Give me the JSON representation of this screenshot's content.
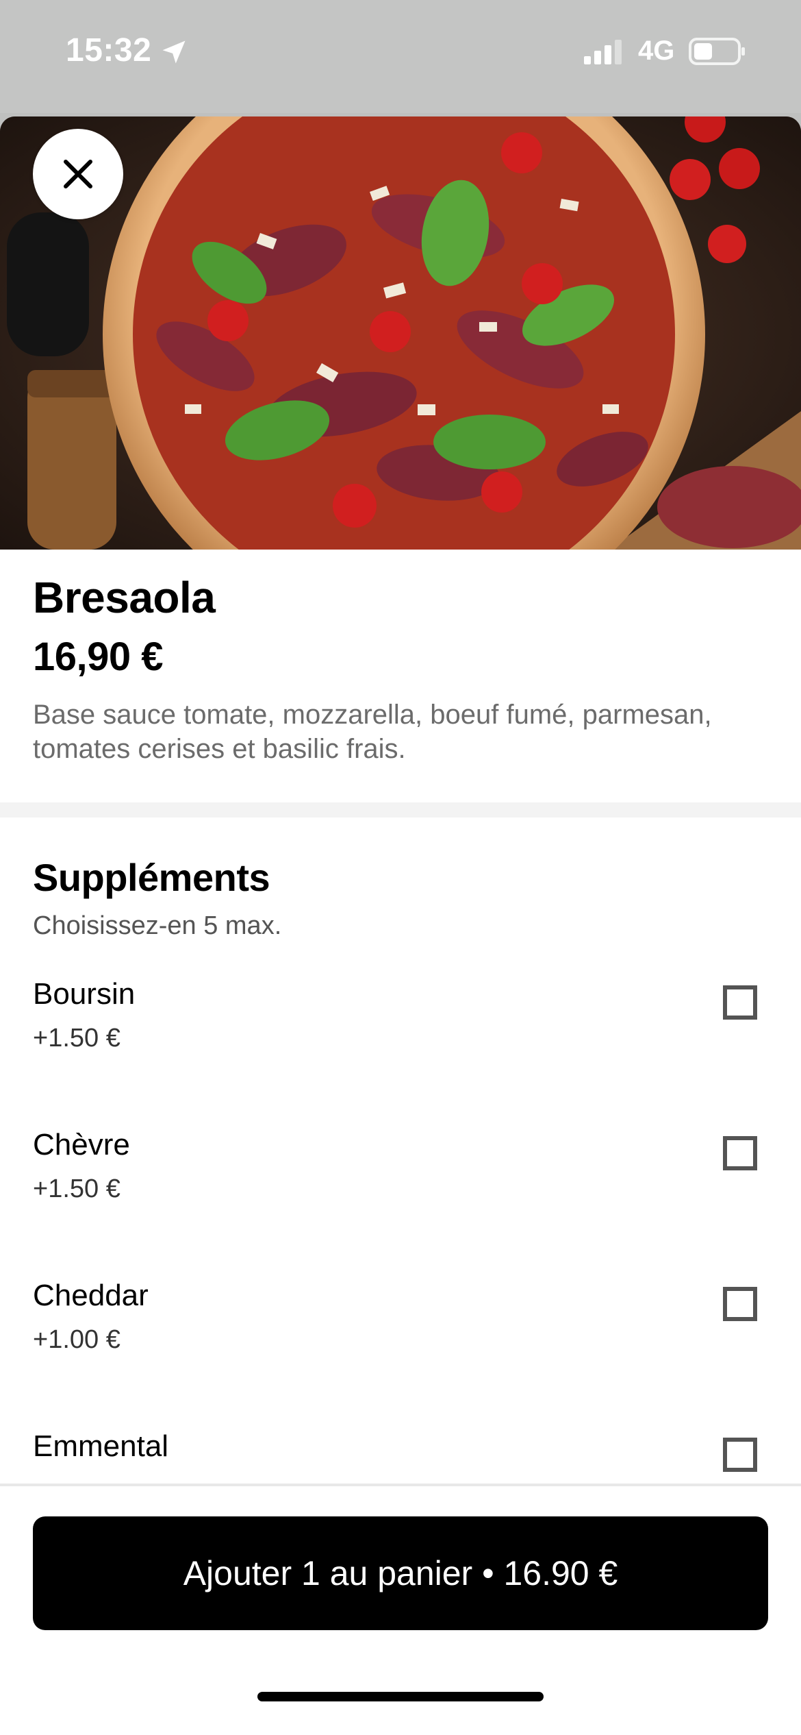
{
  "status_bar": {
    "time": "15:32",
    "network": "4G"
  },
  "item": {
    "title": "Bresaola",
    "price": "16,90 €",
    "description": "Base sauce tomate, mozzarella, boeuf fumé, parmesan, tomates cerises et basilic frais."
  },
  "supplements": {
    "title": "Suppléments",
    "subtitle": "Choisissez-en 5 max.",
    "options": [
      {
        "name": "Boursin",
        "price": "+1.50 €",
        "checked": false
      },
      {
        "name": "Chèvre",
        "price": "+1.50 €",
        "checked": false
      },
      {
        "name": "Cheddar",
        "price": "+1.00 €",
        "checked": false
      },
      {
        "name": "Emmental",
        "price": "",
        "checked": false
      }
    ]
  },
  "footer": {
    "add_button_label": "Ajouter 1 au panier • 16.90 €"
  },
  "icons": [
    "location-arrow-icon",
    "signal-icon",
    "battery-icon",
    "close-icon"
  ],
  "colors": {
    "button_bg": "#000000",
    "button_text": "#ffffff",
    "muted_text": "#6b6b6b"
  }
}
